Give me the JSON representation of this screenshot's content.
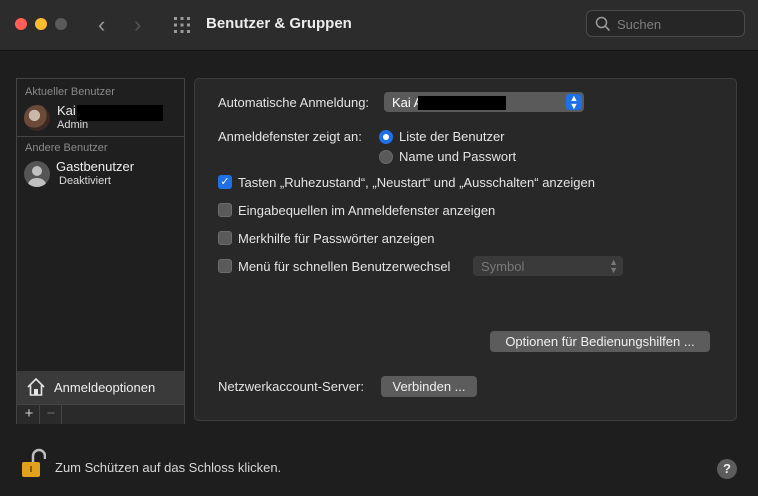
{
  "window": {
    "title": "Benutzer & Gruppen",
    "search_placeholder": "Suchen"
  },
  "sidebar": {
    "current_section": "Aktueller Benutzer",
    "current_user": {
      "name": "Kai",
      "role": "Admin"
    },
    "other_section": "Andere Benutzer",
    "guest_user": {
      "name": "Gastbenutzer",
      "role": "Deaktiviert"
    },
    "login_options": "Anmeldeoptionen",
    "add_symbol": "+",
    "remove_symbol": "−"
  },
  "panel": {
    "auto_login_label": "Automatische Anmeldung:",
    "auto_login_value": "Kai A",
    "login_window_label": "Anmeldefenster zeigt an:",
    "radio_options": [
      {
        "label": "Liste der Benutzer",
        "selected": true
      },
      {
        "label": "Name und Passwort",
        "selected": false
      }
    ],
    "checkboxes": [
      {
        "label": "Tasten „Ruhezustand“, „Neustart“ und „Ausschalten“ anzeigen",
        "checked": true
      },
      {
        "label": "Eingabequellen im Anmeldefenster anzeigen",
        "checked": false
      },
      {
        "label": "Merkhilfe für Passwörter anzeigen",
        "checked": false
      },
      {
        "label": "Menü für schnellen Benutzerwechsel",
        "checked": false
      }
    ],
    "fast_switch_popup": "Symbol",
    "accessibility_button": "Optionen für Bedienungshilfen ...",
    "network_label": "Netzwerkaccount-Server:",
    "connect_button": "Verbinden ..."
  },
  "footer": {
    "lock_text": "Zum Schützen auf das Schloss klicken.",
    "help": "?"
  },
  "colors": {
    "accent": "#1f6fe5",
    "background": "#1e1e1e"
  }
}
